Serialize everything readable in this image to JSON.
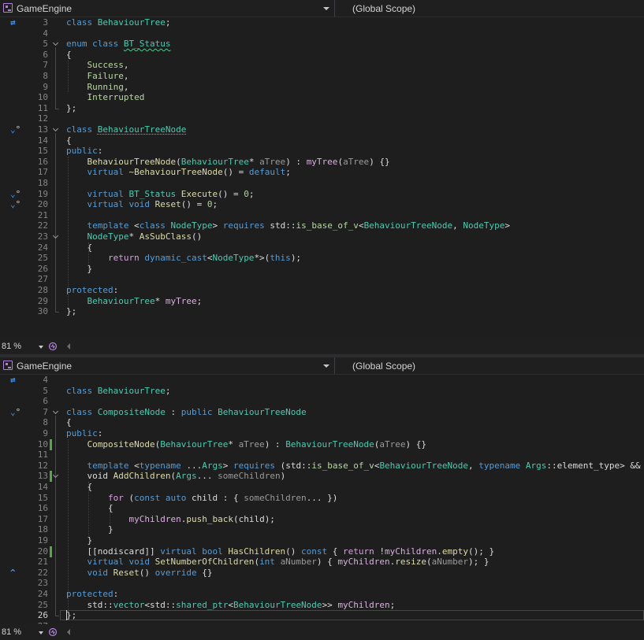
{
  "panes": [
    {
      "project": "GameEngine",
      "scope": "(Global Scope)",
      "zoom": "81 %",
      "lines": [
        {
          "n": "3",
          "t": [
            [
              "kw",
              "class "
            ],
            [
              "ty",
              "BehaviourTree"
            ],
            [
              "p",
              ";"
            ]
          ]
        },
        {
          "n": "4",
          "t": []
        },
        {
          "n": "5",
          "t": [
            [
              "kw",
              "enum class "
            ],
            [
              "ty sq",
              "BT_Status"
            ]
          ]
        },
        {
          "n": "6",
          "t": [
            [
              "p",
              "{"
            ]
          ]
        },
        {
          "n": "7",
          "t": [
            [
              "p",
              "    "
            ],
            [
              "enm",
              "Success"
            ],
            [
              "p",
              ","
            ]
          ]
        },
        {
          "n": "8",
          "t": [
            [
              "p",
              "    "
            ],
            [
              "enm",
              "Failure"
            ],
            [
              "p",
              ","
            ]
          ]
        },
        {
          "n": "9",
          "t": [
            [
              "p",
              "    "
            ],
            [
              "enm",
              "Running"
            ],
            [
              "p",
              ","
            ]
          ]
        },
        {
          "n": "10",
          "t": [
            [
              "p",
              "    "
            ],
            [
              "enm",
              "Interrupted"
            ]
          ]
        },
        {
          "n": "11",
          "t": [
            [
              "p",
              "};"
            ]
          ]
        },
        {
          "n": "12",
          "t": []
        },
        {
          "n": "13",
          "t": [
            [
              "kw",
              "class "
            ],
            [
              "ty dq",
              "BehaviourTreeNode"
            ]
          ]
        },
        {
          "n": "14",
          "t": [
            [
              "p",
              "{"
            ]
          ]
        },
        {
          "n": "15",
          "t": [
            [
              "kw",
              "public"
            ],
            [
              "p",
              ":"
            ]
          ]
        },
        {
          "n": "16",
          "t": [
            [
              "p",
              "    "
            ],
            [
              "fn",
              "BehaviourTreeNode"
            ],
            [
              "p",
              "("
            ],
            [
              "ty",
              "BehaviourTree"
            ],
            [
              "p",
              "* "
            ],
            [
              "par",
              "aTree"
            ],
            [
              "p",
              ") : "
            ],
            [
              "mem",
              "myTree"
            ],
            [
              "p",
              "("
            ],
            [
              "par",
              "aTree"
            ],
            [
              "p",
              ") {}"
            ]
          ]
        },
        {
          "n": "17",
          "t": [
            [
              "p",
              "    "
            ],
            [
              "kw",
              "virtual "
            ],
            [
              "fn",
              "~BehaviourTreeNode"
            ],
            [
              "p",
              "() = "
            ],
            [
              "kw",
              "default"
            ],
            [
              "p",
              ";"
            ]
          ]
        },
        {
          "n": "18",
          "t": []
        },
        {
          "n": "19",
          "t": [
            [
              "p",
              "    "
            ],
            [
              "kw",
              "virtual "
            ],
            [
              "ty",
              "BT_Status "
            ],
            [
              "fn",
              "Execute"
            ],
            [
              "p",
              "() = "
            ],
            [
              "num",
              "0"
            ],
            [
              "p",
              ";"
            ]
          ]
        },
        {
          "n": "20",
          "t": [
            [
              "p",
              "    "
            ],
            [
              "kw",
              "virtual void "
            ],
            [
              "fn",
              "Reset"
            ],
            [
              "p",
              "() = "
            ],
            [
              "num",
              "0"
            ],
            [
              "p",
              ";"
            ]
          ]
        },
        {
          "n": "21",
          "t": []
        },
        {
          "n": "22",
          "t": [
            [
              "p",
              "    "
            ],
            [
              "kw",
              "template "
            ],
            [
              "p",
              "<"
            ],
            [
              "kw",
              "class "
            ],
            [
              "ty",
              "NodeType"
            ],
            [
              "p",
              "> "
            ],
            [
              "kw",
              "requires "
            ],
            [
              "p",
              "std::"
            ],
            [
              "tp",
              "is_base_of_v"
            ],
            [
              "p",
              "<"
            ],
            [
              "ty",
              "BehaviourTreeNode"
            ],
            [
              "p",
              ", "
            ],
            [
              "ty",
              "NodeType"
            ],
            [
              "p",
              ">"
            ]
          ]
        },
        {
          "n": "23",
          "t": [
            [
              "p",
              "    "
            ],
            [
              "ty",
              "NodeType"
            ],
            [
              "p",
              "* "
            ],
            [
              "fn",
              "AsSubClass"
            ],
            [
              "p",
              "()"
            ]
          ]
        },
        {
          "n": "24",
          "t": [
            [
              "p",
              "    {"
            ]
          ]
        },
        {
          "n": "25",
          "t": [
            [
              "p",
              "        "
            ],
            [
              "ctl",
              "return "
            ],
            [
              "kw",
              "dynamic_cast"
            ],
            [
              "p",
              "<"
            ],
            [
              "ty",
              "NodeType"
            ],
            [
              "p",
              "*>("
            ],
            [
              "kw",
              "this"
            ],
            [
              "p",
              ");"
            ]
          ]
        },
        {
          "n": "26",
          "t": [
            [
              "p",
              "    }"
            ]
          ]
        },
        {
          "n": "27",
          "t": []
        },
        {
          "n": "28",
          "t": [
            [
              "kw",
              "protected"
            ],
            [
              "p",
              ":"
            ]
          ]
        },
        {
          "n": "29",
          "t": [
            [
              "p",
              "    "
            ],
            [
              "ty",
              "BehaviourTree"
            ],
            [
              "p",
              "* "
            ],
            [
              "mem",
              "myTree"
            ],
            [
              "p",
              ";"
            ]
          ]
        },
        {
          "n": "30",
          "t": [
            [
              "p",
              "};"
            ]
          ]
        }
      ]
    },
    {
      "project": "GameEngine",
      "scope": "(Global Scope)",
      "zoom": "81 %",
      "lines": [
        {
          "n": "4",
          "t": []
        },
        {
          "n": "5",
          "t": [
            [
              "kw",
              "class "
            ],
            [
              "ty",
              "BehaviourTree"
            ],
            [
              "p",
              ";"
            ]
          ]
        },
        {
          "n": "6",
          "t": []
        },
        {
          "n": "7",
          "t": [
            [
              "kw",
              "class "
            ],
            [
              "ty",
              "CompositeNode "
            ],
            [
              "p",
              ": "
            ],
            [
              "kw",
              "public "
            ],
            [
              "ty",
              "BehaviourTreeNode"
            ]
          ]
        },
        {
          "n": "8",
          "t": [
            [
              "p",
              "{"
            ]
          ]
        },
        {
          "n": "9",
          "t": [
            [
              "kw",
              "public"
            ],
            [
              "p",
              ":"
            ]
          ]
        },
        {
          "n": "10",
          "t": [
            [
              "p",
              "    "
            ],
            [
              "fn",
              "CompositeNode"
            ],
            [
              "p",
              "("
            ],
            [
              "ty",
              "BehaviourTree"
            ],
            [
              "p",
              "* "
            ],
            [
              "par",
              "aTree"
            ],
            [
              "p",
              ") : "
            ],
            [
              "ty",
              "BehaviourTreeNode"
            ],
            [
              "p",
              "("
            ],
            [
              "par",
              "aTree"
            ],
            [
              "p",
              ") {}"
            ]
          ]
        },
        {
          "n": "11",
          "t": []
        },
        {
          "n": "12",
          "t": [
            [
              "p",
              "    "
            ],
            [
              "kw",
              "template "
            ],
            [
              "p",
              "<"
            ],
            [
              "kw",
              "typename "
            ],
            [
              "p",
              "..."
            ],
            [
              "ty",
              "Args"
            ],
            [
              "p",
              "> "
            ],
            [
              "kw",
              "requires "
            ],
            [
              "p",
              "(std::"
            ],
            [
              "tp",
              "is_base_of_v"
            ],
            [
              "p",
              "<"
            ],
            [
              "ty",
              "BehaviourTreeNode"
            ],
            [
              "p",
              ", "
            ],
            [
              "kw",
              "typename "
            ],
            [
              "ty",
              "Args"
            ],
            [
              "p",
              "::element_type> && ...)"
            ]
          ]
        },
        {
          "n": "13",
          "t": [
            [
              "p",
              "    void "
            ],
            [
              "fn",
              "AddChildren"
            ],
            [
              "p",
              "("
            ],
            [
              "ty",
              "Args"
            ],
            [
              "p",
              "... "
            ],
            [
              "par",
              "someChildren"
            ],
            [
              "p",
              ")"
            ]
          ]
        },
        {
          "n": "14",
          "t": [
            [
              "p",
              "    {"
            ]
          ]
        },
        {
          "n": "15",
          "t": [
            [
              "p",
              "        "
            ],
            [
              "ctl",
              "for "
            ],
            [
              "p",
              "("
            ],
            [
              "kw",
              "const auto "
            ],
            [
              "p",
              "child : { "
            ],
            [
              "par",
              "someChildren"
            ],
            [
              "p",
              "... })"
            ]
          ]
        },
        {
          "n": "16",
          "t": [
            [
              "p",
              "        {"
            ]
          ]
        },
        {
          "n": "17",
          "t": [
            [
              "p",
              "            "
            ],
            [
              "mem",
              "myChildren"
            ],
            [
              "p",
              "."
            ],
            [
              "fn",
              "push_back"
            ],
            [
              "p",
              "(child);"
            ]
          ]
        },
        {
          "n": "18",
          "t": [
            [
              "p",
              "        }"
            ]
          ]
        },
        {
          "n": "19",
          "t": [
            [
              "p",
              "    }"
            ]
          ]
        },
        {
          "n": "20",
          "t": [
            [
              "p",
              "    [[nodiscard]] "
            ],
            [
              "kw",
              "virtual bool "
            ],
            [
              "fn",
              "HasChildren"
            ],
            [
              "p",
              "() "
            ],
            [
              "kw",
              "const "
            ],
            [
              "p",
              "{ "
            ],
            [
              "ctl",
              "return "
            ],
            [
              "p",
              "!"
            ],
            [
              "mem",
              "myChildren"
            ],
            [
              "p",
              "."
            ],
            [
              "fn",
              "empty"
            ],
            [
              "p",
              "(); }"
            ]
          ]
        },
        {
          "n": "21",
          "t": [
            [
              "p",
              "    "
            ],
            [
              "kw",
              "virtual void "
            ],
            [
              "fn",
              "SetNumberOfChildren"
            ],
            [
              "p",
              "("
            ],
            [
              "kw",
              "int "
            ],
            [
              "par",
              "aNumber"
            ],
            [
              "p",
              ") { "
            ],
            [
              "mem",
              "myChildren"
            ],
            [
              "p",
              "."
            ],
            [
              "fn",
              "resize"
            ],
            [
              "p",
              "("
            ],
            [
              "par",
              "aNumber"
            ],
            [
              "p",
              "); }"
            ]
          ]
        },
        {
          "n": "22",
          "t": [
            [
              "p",
              "    "
            ],
            [
              "kw",
              "void "
            ],
            [
              "fn",
              "Reset"
            ],
            [
              "p",
              "() "
            ],
            [
              "kw",
              "override "
            ],
            [
              "p",
              "{}"
            ]
          ]
        },
        {
          "n": "23",
          "t": []
        },
        {
          "n": "24",
          "t": [
            [
              "kw",
              "protected"
            ],
            [
              "p",
              ":"
            ]
          ]
        },
        {
          "n": "25",
          "t": [
            [
              "p",
              "    std::"
            ],
            [
              "ty",
              "vector"
            ],
            [
              "p",
              "<std::"
            ],
            [
              "ty",
              "shared_ptr"
            ],
            [
              "p",
              "<"
            ],
            [
              "ty",
              "BehaviourTreeNode"
            ],
            [
              "p",
              ">> "
            ],
            [
              "mem",
              "myChildren"
            ],
            [
              "p",
              ";"
            ]
          ]
        },
        {
          "n": "26",
          "t": [
            [
              "p",
              "};"
            ]
          ]
        },
        {
          "n": "27",
          "t": []
        }
      ]
    }
  ],
  "gutter_icons": {
    "pane1": {
      "3": "swap-icon",
      "13": "override-icon",
      "19": "override-icon",
      "20": "override-icon"
    },
    "pane2": {
      "4": "swap-icon",
      "7": "override-icon",
      "22": "overrides-up-icon"
    }
  },
  "colors": {
    "keyword": "#569cd6",
    "type": "#4ec9b0",
    "function": "#dcdcaa",
    "member": "#dab0df",
    "parameter": "#9a9a9a",
    "number": "#b5cea8",
    "enum": "#b8d7a3",
    "control": "#d8a0df",
    "changed": "#57a64a"
  }
}
